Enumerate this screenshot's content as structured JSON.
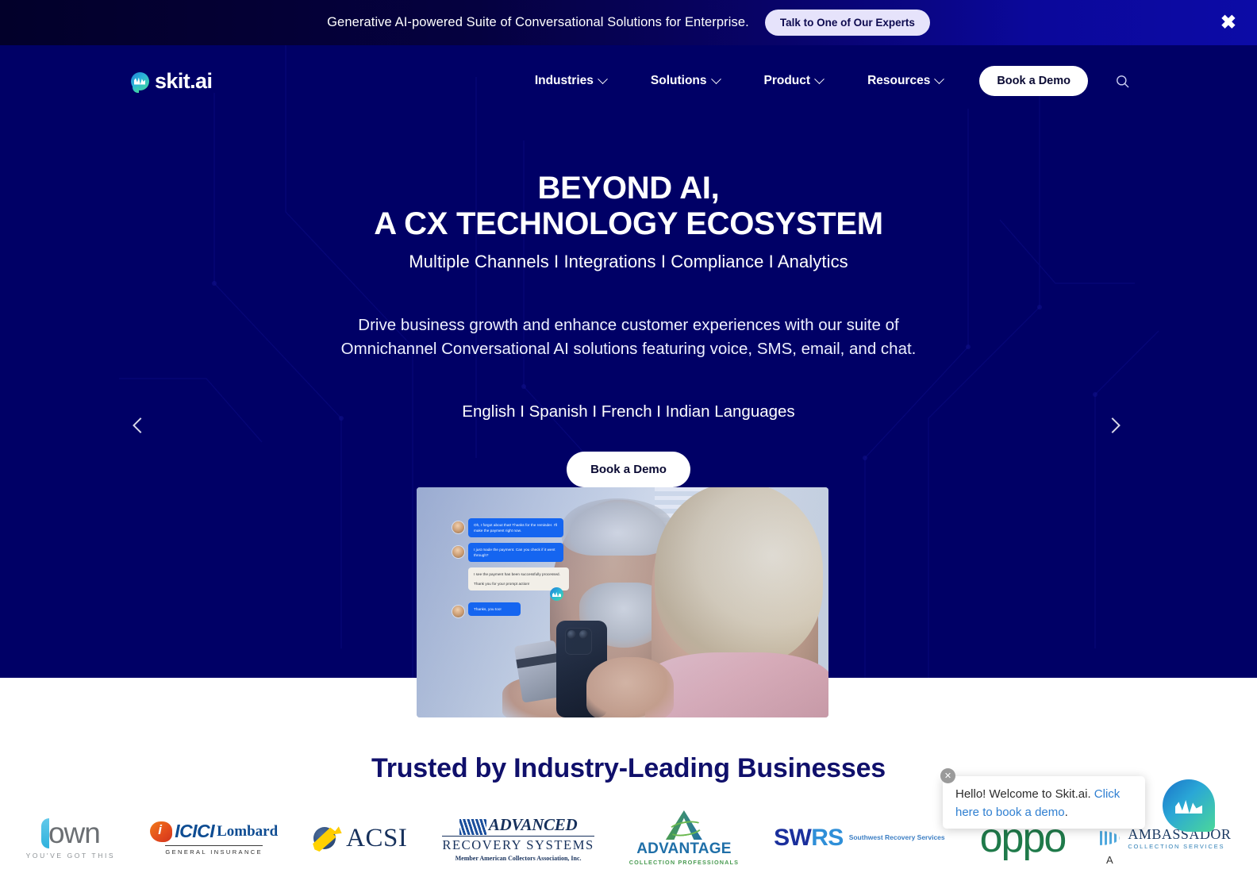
{
  "banner": {
    "text": "Generative AI-powered Suite of Conversational Solutions for Enterprise.",
    "cta": "Talk to One of Our Experts",
    "close": "✖"
  },
  "nav": {
    "logo": "skit.ai",
    "items": [
      {
        "label": "Industries"
      },
      {
        "label": "Solutions"
      },
      {
        "label": "Product"
      },
      {
        "label": "Resources"
      }
    ],
    "cta": "Book a Demo",
    "search_icon": "search-icon"
  },
  "hero": {
    "title_line1": "BEYOND AI,",
    "title_line2": "A CX TECHNOLOGY ECOSYSTEM",
    "subtitle": "Multiple Channels I Integrations I Compliance I Analytics",
    "paragraph_line1": "Drive business growth and enhance customer experiences with our suite of",
    "paragraph_line2": "Omnichannel Conversational AI solutions featuring voice, SMS, email, and chat.",
    "languages": "English I Spanish I French I Indian Languages",
    "cta": "Book a Demo",
    "prev_label": "‹",
    "next_label": "›"
  },
  "hero_image": {
    "messages": [
      {
        "from": "user",
        "text": "Oh, I forgot about that! Thanks for the reminder. I'll make the payment right now."
      },
      {
        "from": "user",
        "text": "I just made the payment. Can you check if it went through?"
      },
      {
        "from": "agent",
        "line1": "I see the payment has been successfully processed.",
        "line2": "Thank you for your prompt action!"
      },
      {
        "from": "user",
        "text": "Thanks, you too!"
      }
    ]
  },
  "trusted": {
    "heading": "Trusted by Industry-Leading Businesses",
    "logos": [
      {
        "name": "own",
        "word": "own",
        "tagline": "YOU'VE GOT THIS"
      },
      {
        "name": "icici-lombard",
        "word": "ICICI",
        "word2": "Lombard",
        "tagline": "GENERAL INSURANCE"
      },
      {
        "name": "acsi",
        "word": "ACSI"
      },
      {
        "name": "advanced-recovery-systems",
        "line1": "ADVANCED",
        "line2": "RECOVERY SYSTEMS",
        "line3": "Member American Collectors Association, Inc."
      },
      {
        "name": "advantage-collection-professionals",
        "word": "ADVANTAGE",
        "tagline": "COLLECTION PROFESSIONALS"
      },
      {
        "name": "swrs",
        "word": "SW",
        "word2": "RS",
        "tagline": "Southwest Recovery Services"
      },
      {
        "name": "oppo",
        "word": "oppo"
      },
      {
        "name": "ambassador-collection-services",
        "word": "AMBASSADOR",
        "tagline": "COLLECTION SERVICES"
      }
    ]
  },
  "chat_widget": {
    "greeting": "Hello! Welcome to Skit.ai.",
    "link": "Click here to book a demo",
    "period": ".",
    "close": "✕"
  },
  "accessibility": {
    "marker": "A"
  },
  "colors": {
    "hero_bg": "#000066",
    "banner_left": "#02002a",
    "banner_right": "#0c0ba6",
    "heading_navy": "#10106b",
    "accent_blue": "#1565f0",
    "link_blue": "#2f7fd1"
  }
}
